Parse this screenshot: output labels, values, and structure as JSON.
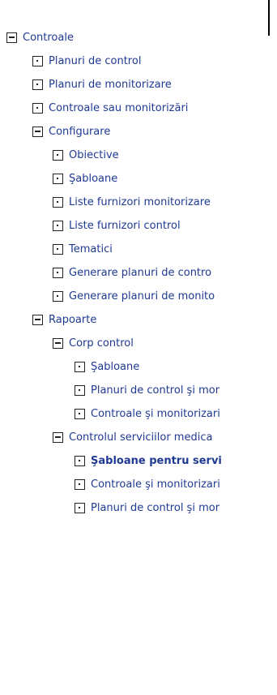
{
  "tree": {
    "root": {
      "label": "Controale",
      "icon": "collapse-icon"
    },
    "items": [
      {
        "label": "Planuri de control",
        "icon": "leaf-icon"
      },
      {
        "label": "Planuri de monitorizare",
        "icon": "leaf-icon"
      },
      {
        "label": "Controale sau monitorizări",
        "icon": "leaf-icon"
      },
      {
        "label": "Configurare",
        "icon": "collapse-icon"
      },
      {
        "label": "Obiective",
        "icon": "leaf-icon"
      },
      {
        "label": "Şabloane",
        "icon": "leaf-icon"
      },
      {
        "label": "Liste furnizori monitorizare",
        "icon": "leaf-icon"
      },
      {
        "label": "Liste furnizori control",
        "icon": "leaf-icon"
      },
      {
        "label": "Tematici",
        "icon": "leaf-icon"
      },
      {
        "label": "Generare planuri de contro",
        "icon": "leaf-icon"
      },
      {
        "label": "Generare planuri de monito",
        "icon": "leaf-icon"
      },
      {
        "label": "Rapoarte",
        "icon": "collapse-icon"
      },
      {
        "label": "Corp control",
        "icon": "collapse-icon"
      },
      {
        "label": "Şabloane",
        "icon": "leaf-icon"
      },
      {
        "label": "Planuri de control şi mor",
        "icon": "leaf-icon"
      },
      {
        "label": "Controale şi monitorizari",
        "icon": "leaf-icon"
      },
      {
        "label": "Controlul serviciilor medica",
        "icon": "collapse-icon"
      },
      {
        "label": "Şabloane pentru servi",
        "icon": "leaf-icon",
        "selected": true
      },
      {
        "label": "Controale şi monitorizari",
        "icon": "leaf-icon"
      },
      {
        "label": "Planuri de control şi mor",
        "icon": "leaf-icon"
      }
    ]
  },
  "colors": {
    "link_text": "#1f3a93",
    "box_border": "#222222",
    "background": "#ffffff"
  }
}
